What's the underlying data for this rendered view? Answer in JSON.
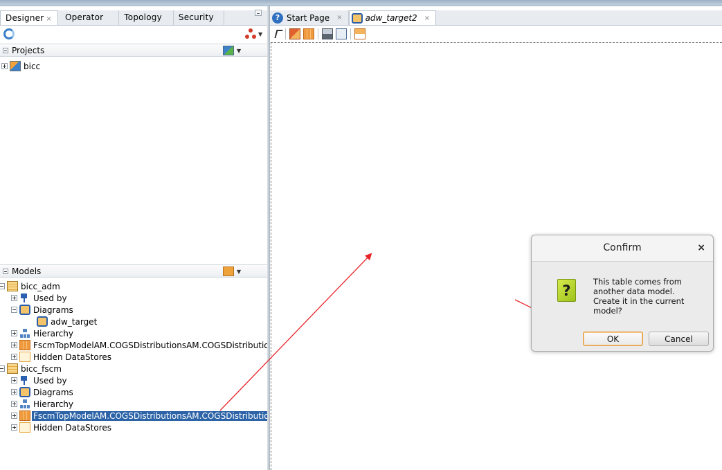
{
  "left_tabs": [
    {
      "label": "Designer",
      "closable": true
    },
    {
      "label": "Operator",
      "closable": false
    },
    {
      "label": "Topology",
      "closable": false
    },
    {
      "label": "Security",
      "closable": false
    }
  ],
  "projects": {
    "header": "Projects",
    "items": [
      {
        "label": "bicc"
      }
    ]
  },
  "models": {
    "header": "Models",
    "tree": [
      {
        "label": "bicc_adm"
      },
      {
        "label": "Used by"
      },
      {
        "label": "Diagrams"
      },
      {
        "label": "adw_target"
      },
      {
        "label": "Hierarchy"
      },
      {
        "label": "FscmTopModelAM.COGSDistributionsAM.COGSDistributions"
      },
      {
        "label": "Hidden DataStores"
      },
      {
        "label": "bicc_fscm"
      },
      {
        "label": "Used by"
      },
      {
        "label": "Diagrams"
      },
      {
        "label": "Hierarchy"
      },
      {
        "label": "FscmTopModelAM.COGSDistributionsAM.COGSDistributions"
      },
      {
        "label": "Hidden DataStores"
      }
    ]
  },
  "editor_tabs": [
    {
      "label": "Start Page"
    },
    {
      "label": "adw_target2"
    }
  ],
  "close_glyph": "×",
  "dialog": {
    "title": "Confirm",
    "close": "×",
    "icon_glyph": "?",
    "message": "This table comes from\nanother data model.\n Create it in the current\nmodel?",
    "ok_label": "OK",
    "cancel_label": "Cancel"
  },
  "colors": {
    "selection": "#2d64a8",
    "annotation_arrow": "#e8232a",
    "ok_focus_border": "#e29a3c"
  }
}
